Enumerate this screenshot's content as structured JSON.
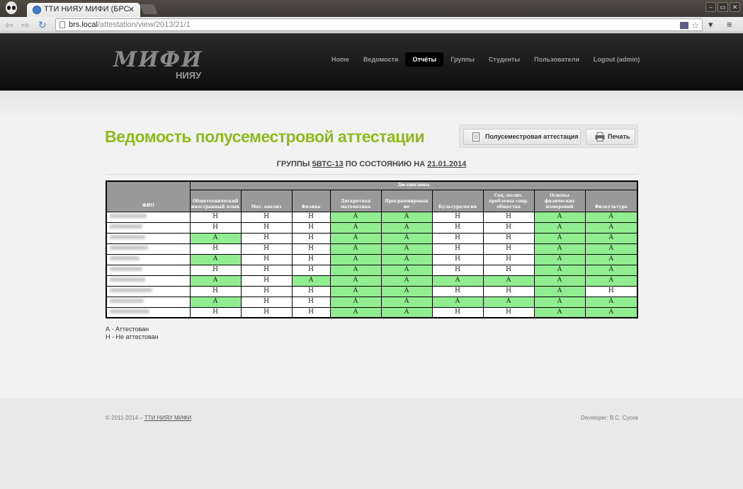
{
  "browser": {
    "tab_title": "ТТИ НИЯУ МИФИ (БРС",
    "url_host": "brs.local",
    "url_path": "/attestation/view/2013/21/1",
    "window_buttons": [
      "–",
      "▭",
      "✕"
    ]
  },
  "header": {
    "logo_text": "МИФИ",
    "logo_sub": "НИЯУ",
    "nav": [
      {
        "label": "Home"
      },
      {
        "label": "Ведомости"
      },
      {
        "label": "Отчёты",
        "active": true
      },
      {
        "label": "Группы"
      },
      {
        "label": "Студенты"
      },
      {
        "label": "Пользователи"
      },
      {
        "label": "Logout (admin)"
      }
    ]
  },
  "main": {
    "title": "Ведомость полусеместровой аттестации",
    "btn_midterm": "Полусеместровая аттестация",
    "btn_print": "Печать",
    "subtitle_prefix": "ГРУППЫ",
    "group": "5ВТС-13",
    "subtitle_mid": "ПО СОСТОЯНИЮ НА",
    "date": "21.01.2014"
  },
  "table": {
    "col_fio": "ФИО",
    "disciplines_header": "Дисциплины",
    "columns": [
      "Общетехнический иностранный язык",
      "Мат. анализ",
      "Физика",
      "Дискретная математика",
      "Программирован ие",
      "Культурология",
      "Соц.-полит. проблемы совр. общества",
      "Основы физических измерений",
      "Физкультура"
    ],
    "rows": [
      [
        "Н",
        "Н",
        "Н",
        "А",
        "А",
        "Н",
        "Н",
        "А",
        "А"
      ],
      [
        "Н",
        "Н",
        "Н",
        "А",
        "А",
        "Н",
        "Н",
        "А",
        "А"
      ],
      [
        "А",
        "Н",
        "Н",
        "А",
        "А",
        "Н",
        "Н",
        "А",
        "А"
      ],
      [
        "Н",
        "Н",
        "Н",
        "А",
        "А",
        "Н",
        "Н",
        "А",
        "А"
      ],
      [
        "А",
        "Н",
        "Н",
        "А",
        "А",
        "Н",
        "Н",
        "А",
        "А"
      ],
      [
        "Н",
        "Н",
        "Н",
        "А",
        "А",
        "Н",
        "Н",
        "А",
        "А"
      ],
      [
        "А",
        "Н",
        "А",
        "А",
        "А",
        "А",
        "А",
        "А",
        "А"
      ],
      [
        "Н",
        "Н",
        "Н",
        "А",
        "А",
        "Н",
        "Н",
        "А",
        "Н"
      ],
      [
        "А",
        "Н",
        "Н",
        "А",
        "А",
        "А",
        "А",
        "А",
        "А"
      ],
      [
        "Н",
        "Н",
        "Н",
        "А",
        "А",
        "Н",
        "Н",
        "А",
        "А"
      ]
    ]
  },
  "legend": {
    "a": "А - Аттестован",
    "n": "Н - Не аттестован"
  },
  "footer": {
    "copyright": "© 2011-2014 –",
    "link": "ТТИ НИЯУ МИФИ",
    "developer": "Developer: В.С. Сусев"
  },
  "colors": {
    "title_green": "#8dbb1d",
    "pass_green": "#90ee90",
    "header_bg": "#111111"
  }
}
